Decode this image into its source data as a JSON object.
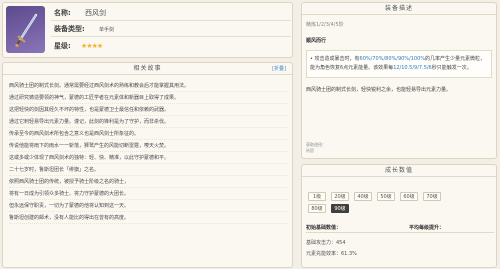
{
  "info": {
    "name_label": "名称:",
    "name_value": "西风剑",
    "type_label": "装备类型:",
    "type_value": "单手剑",
    "rarity_label": "星级:",
    "rarity_stars": "★★★★"
  },
  "story": {
    "title": "相关故事",
    "action": "[折叠]",
    "lines": [
      "西风骑士团的制式长剑。通常需要经过西风剑术的熟练和教会后才能掌握其用法。",
      "通过研究铸造要领的神气，蒙德的工匠学者在元素体和新器目上取得了成果。",
      "这把轻快的剑因其经久不坏的特性，也是蒙德卫士最信任和依赖的武器。",
      "通过它刺轻易导出元素力量。谨记，此剑的锋利是为了守护，而非杀伐。",
      "传承至今的西风剑术所包含之意义也是西风剑士所象征的。",
      "传说他能将雨下的雨水一一斩落，狮鹫产生的风能切断雷霆，嘹天火焚。",
      "这或多或少体现了西风剑术的独特：轻、快、精准，以此守护蒙德和平。",
      "二十七岁时，鲁斯坦团长「绯旗」之名。",
      "依照西风骑士团的传统，被授予骑士阶级之名的骑士，",
      "将有一日成为引领众多骑士、将力守护蒙德的大团长。",
      "但永远保守职责，一切为了蒙德的他将认知到这一天。",
      "鲁斯坦创建的邮术，没有人能比的得出在曾有的高度。"
    ]
  },
  "refine": {
    "title": "装备描述",
    "level_line": "精炼1/2/3/4/5阶",
    "passive_name": "顺风而行",
    "effect_pre": "• 攻击造成暴击时，有",
    "effect_hl1": "60%/70%/80%/90%/100%",
    "effect_mid": "的几率产生少量元素微粒，能为角色恢复6点元素能量。该效果每",
    "effect_hl2": "12/10.5/9/7.5/6",
    "effect_post": "秒只能触发一次。",
    "desc": "西风骑士团的制式长剑，轻快锐利之余，也能轻易导出元素力量。",
    "foot_label": "获取途径：",
    "foot_value": "祈愿"
  },
  "stats": {
    "title": "成长数值",
    "levels": [
      "1级",
      "20级",
      "40级",
      "50级",
      "60级",
      "70级",
      "80级",
      "90级"
    ],
    "selected": "90级",
    "col1": "初始基础数值：",
    "col2": "平均每级提升：",
    "line1": "基础攻击力：454",
    "line2": "元素充能效率：61.3%"
  }
}
